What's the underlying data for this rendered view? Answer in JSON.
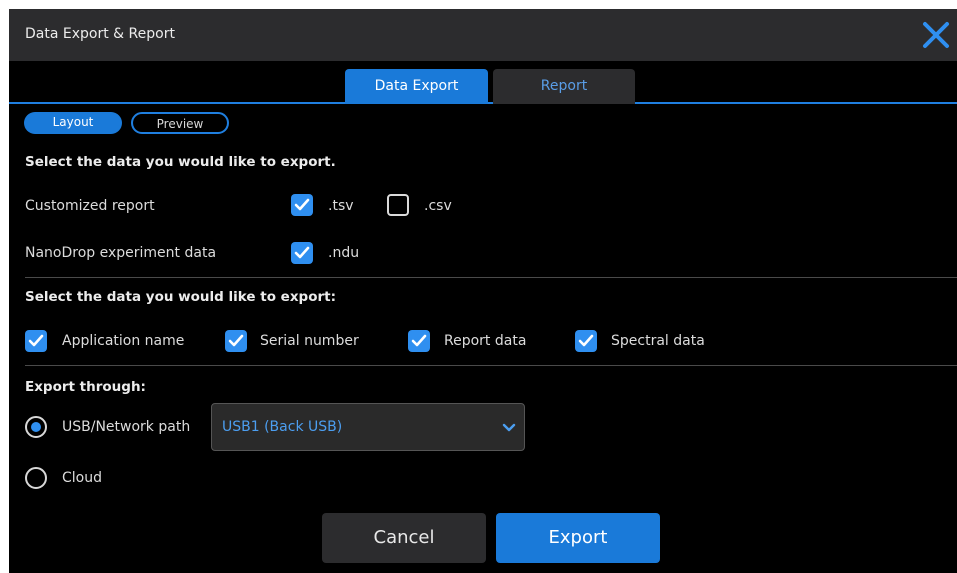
{
  "window": {
    "title": "Data Export & Report",
    "close_icon": "close-icon"
  },
  "tabs": [
    {
      "label": "Data Export",
      "active": true
    },
    {
      "label": "Report",
      "active": false
    }
  ],
  "subtabs": [
    {
      "label": "Layout",
      "active": true
    },
    {
      "label": "Preview",
      "active": false
    }
  ],
  "section1": {
    "heading": "Select the data you would like to export.",
    "rows": [
      {
        "label": "Customized report",
        "options": [
          {
            "label": ".tsv",
            "checked": true
          },
          {
            "label": ".csv",
            "checked": false
          }
        ]
      },
      {
        "label": "NanoDrop experiment data",
        "options": [
          {
            "label": ".ndu",
            "checked": true
          }
        ]
      }
    ]
  },
  "section2": {
    "heading": "Select the data you would like to export:",
    "options": [
      {
        "label": "Application name",
        "checked": true
      },
      {
        "label": "Serial number",
        "checked": true
      },
      {
        "label": "Report data",
        "checked": true
      },
      {
        "label": "Spectral data",
        "checked": true
      }
    ]
  },
  "section3": {
    "heading": "Export through:",
    "options": [
      {
        "label": "USB/Network path",
        "selected": true
      },
      {
        "label": "Cloud",
        "selected": false
      }
    ],
    "destination": {
      "value": "USB1 (Back USB)",
      "icon": "chevron-down-icon"
    }
  },
  "footer": {
    "cancel_label": "Cancel",
    "export_label": "Export"
  },
  "colors": {
    "accent": "#1a7ad9",
    "checkbox": "#2f8ff0",
    "background": "#000000",
    "panel": "#2c2c2e",
    "select_text": "#4c9ef0"
  }
}
